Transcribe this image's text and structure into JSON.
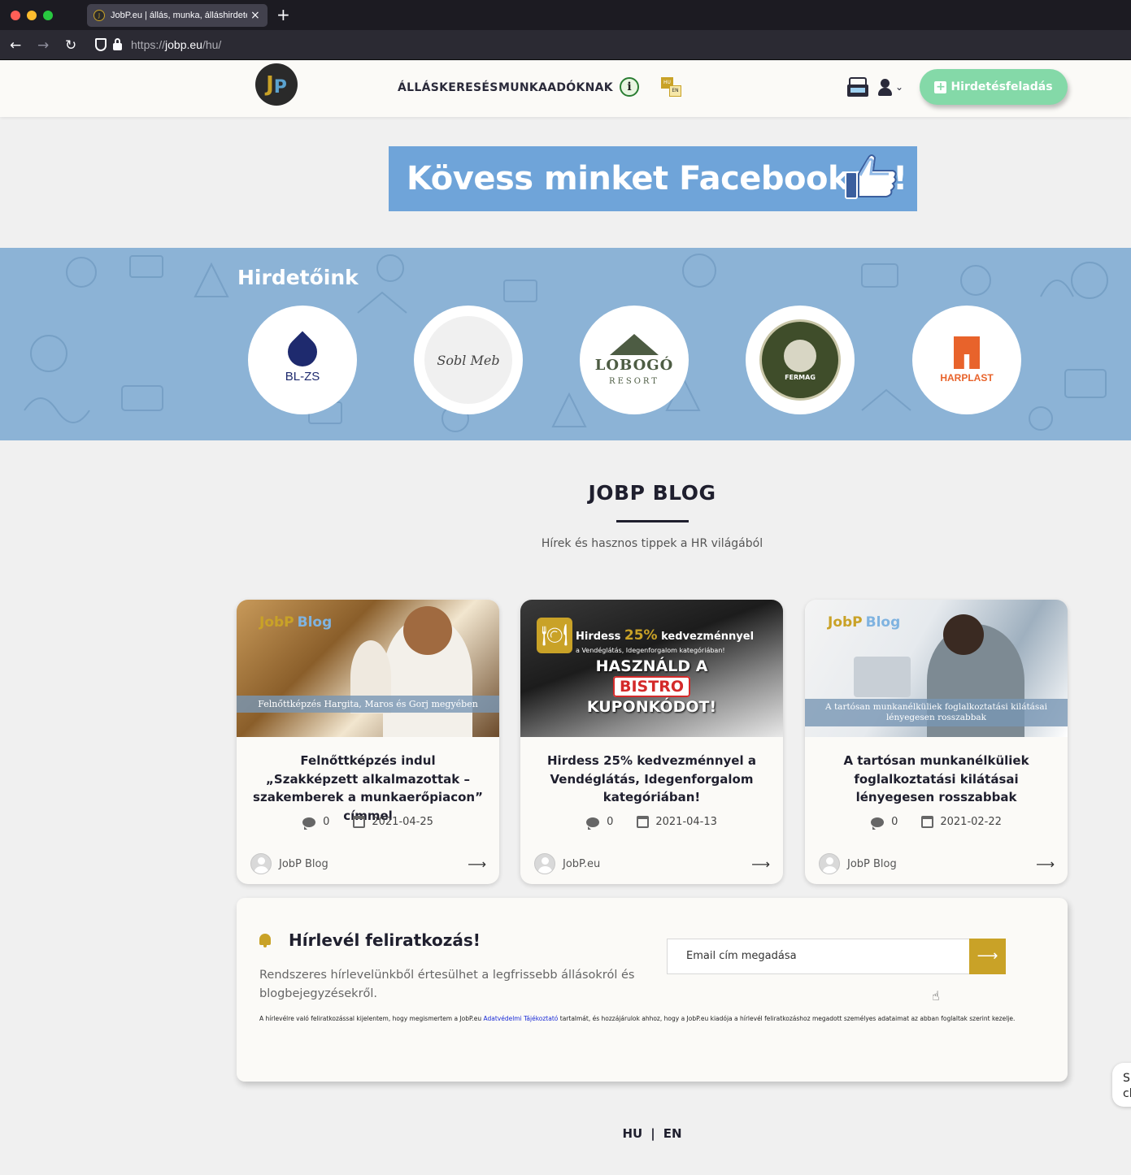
{
  "browser": {
    "tab_title": "JobP.eu | állás, munka, álláshirdetés",
    "url_prefix": "https://",
    "url_host": "jobp.eu",
    "url_path": "/hu/"
  },
  "header": {
    "logo_text": "JP",
    "nav": [
      "ÁLLÁSKERESÉS",
      "MUNKAADÓKNAK"
    ],
    "lang_badges": [
      "HU",
      "EN"
    ],
    "cta_label": "Hirdetésfeladás"
  },
  "facebook_banner": "Kövess minket Facebookon!",
  "advertisers": {
    "title": "Hirdetőink",
    "logos": [
      {
        "name": "BL-ZS",
        "sub": "constr instal"
      },
      {
        "name": "Sobl Meb",
        "sub": ""
      },
      {
        "name": "LOBOGÓ",
        "sub": "RESORT"
      },
      {
        "name": "FERMAG",
        "sub": "WWW.FERMAG.RO"
      },
      {
        "name": "HARPLAST",
        "sub": ""
      }
    ]
  },
  "blog": {
    "title": "JOBP BLOG",
    "subtitle": "Hírek és hasznos tippek a HR világából",
    "posts": [
      {
        "image_brand": "JobP",
        "image_brand_suffix": "Blog",
        "image_caption": "Felnőttképzés Hargita, Maros és Gorj megyében",
        "title": "Felnőttképzés indul „Szakképzett alkalmazottak – szakemberek a munkaerőpiacon” címmel",
        "comments": "0",
        "date": "2021-04-25",
        "author": "JobP Blog"
      },
      {
        "image_promo_top": "Hirdess",
        "image_promo_pct": "25%",
        "image_promo_rest": "kedvezménnyel",
        "image_promo_line2": "a Vendéglátás, Idegenforgalom kategóriában!",
        "image_promo_l1": "HASZNÁLD A",
        "image_promo_l2": "BISTRO",
        "image_promo_l3": "KUPONKÓDOT!",
        "title": "Hirdess 25% kedvezménnyel a Vendéglátás, Idegenforgalom kategóriában!",
        "comments": "0",
        "date": "2021-04-13",
        "author": "JobP.eu"
      },
      {
        "image_brand": "JobP",
        "image_brand_suffix": "Blog",
        "image_caption": "A tartósan munkanélküliek foglalkoztatási kilátásai lényegesen rosszabbak",
        "title": "A tartósan munkanélküliek foglalkoztatási kilátásai lényegesen rosszabbak",
        "comments": "0",
        "date": "2021-02-22",
        "author": "JobP Blog"
      }
    ]
  },
  "newsletter": {
    "title": "Hírlevél feliratkozás!",
    "description": "Rendszeres hírlevelünkből értesülhet a legfrissebb állásokról és blogbejegyzésekről.",
    "input_placeholder": "Email cím megadása",
    "legal_before": "A hírlevélre való feliratkozással kijelentem, hogy megismertem a JobP.eu ",
    "legal_link": "Adatvédelmi Tájékoztató",
    "legal_after": " tartalmát, és hozzájárulok ahhoz, hogy a JobP.eu kiadója a hírlevél feliratkozáshoz megadott személyes adataimat az abban foglaltak szerint kezelje."
  },
  "side_widget": "S\ncl",
  "footer_lang": {
    "hu": "HU",
    "sep": "|",
    "en": "EN"
  },
  "colors": {
    "accent_gold": "#c9a227",
    "cta_green": "#84d9a8",
    "fb_blue": "#6fa4d9",
    "advertisers_bg": "#8cb3d6"
  }
}
